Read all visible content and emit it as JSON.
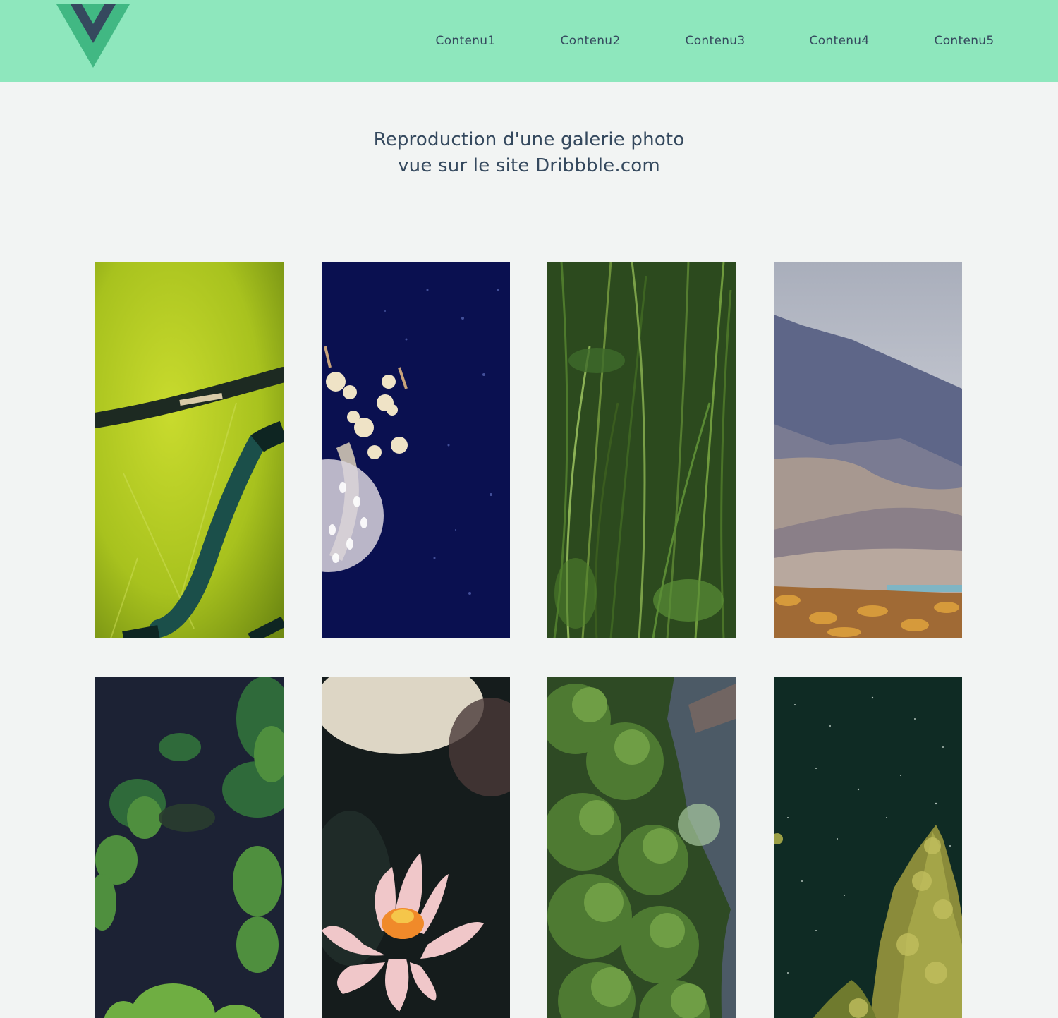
{
  "header": {
    "logo_icon": "vue-logo-icon",
    "brand_colors": {
      "outer": "#41b883",
      "inner": "#35495e",
      "background": "#8ee7bd"
    },
    "nav": [
      {
        "label": "Contenu1"
      },
      {
        "label": "Contenu2"
      },
      {
        "label": "Contenu3"
      },
      {
        "label": "Contenu4"
      },
      {
        "label": "Contenu5"
      }
    ]
  },
  "main": {
    "title_line1": "Reproduction d'une galerie photo",
    "title_line2": "vue sur le site Dribbble.com"
  },
  "gallery": {
    "photos": [
      {
        "subject": "beetle-legs-on-green-leaf"
      },
      {
        "subject": "jellyfish-in-deep-blue-water"
      },
      {
        "subject": "tall-green-grass"
      },
      {
        "subject": "mountain-and-desert-landscape"
      },
      {
        "subject": "oak-leaves-dark-background"
      },
      {
        "subject": "pink-water-lily"
      },
      {
        "subject": "aerial-forest-and-river"
      },
      {
        "subject": "tree-tops-under-starry-sky"
      }
    ]
  }
}
